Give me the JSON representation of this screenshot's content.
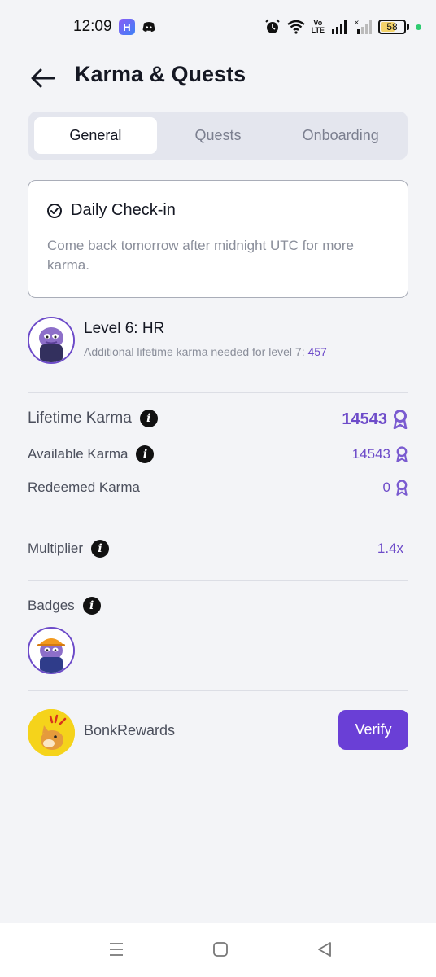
{
  "status_bar": {
    "time": "12:09",
    "volte_line1": "Vo",
    "volte_line2": "LTE",
    "battery": "58",
    "battery_level": 0.58
  },
  "header": {
    "title": "Karma & Quests"
  },
  "tabs": [
    {
      "label": "General",
      "active": true
    },
    {
      "label": "Quests",
      "active": false
    },
    {
      "label": "Onboarding",
      "active": false
    }
  ],
  "checkin": {
    "title": "Daily Check-in",
    "text": "Come back tomorrow after midnight UTC for more karma."
  },
  "level": {
    "title": "Level 6: HR",
    "subtitle": "Additional lifetime karma needed for level 7:",
    "needed": "457"
  },
  "karma": {
    "lifetime_label": "Lifetime Karma",
    "lifetime_value": "14543",
    "available_label": "Available Karma",
    "available_value": "14543",
    "redeemed_label": "Redeemed Karma",
    "redeemed_value": "0"
  },
  "multiplier": {
    "label": "Multiplier",
    "value": "1.4x"
  },
  "badges": {
    "label": "Badges"
  },
  "bonk": {
    "label": "BonkRewards",
    "button": "Verify"
  },
  "colors": {
    "accent": "#6d4bc9",
    "button": "#6a3fd6",
    "background": "#f3f4f7"
  }
}
